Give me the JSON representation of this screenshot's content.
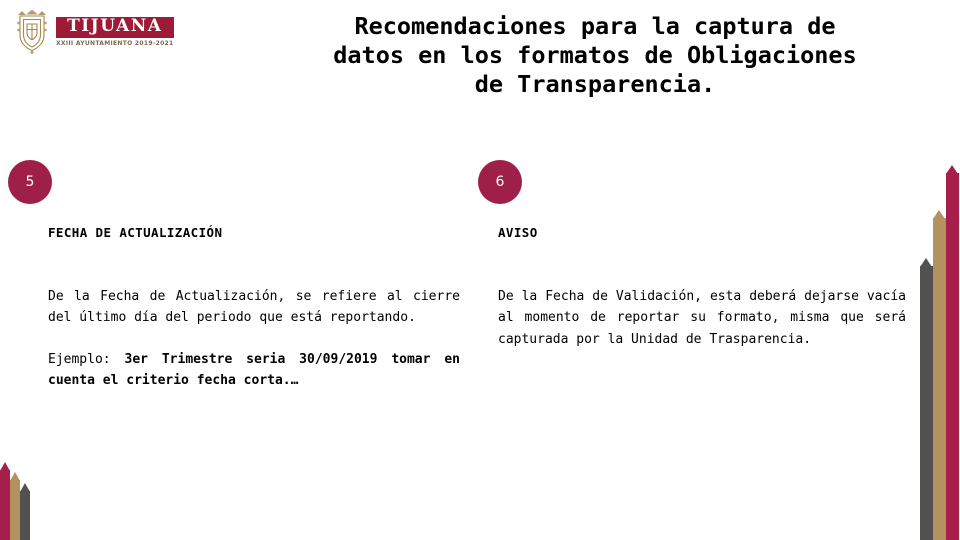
{
  "slide": {
    "background_color": "#ffffff",
    "title": {
      "lines": [
        "Recomendaciones para la captura de",
        "datos en los formatos de Obligaciones",
        "de Transparencia."
      ]
    },
    "logo": {
      "crest_icon": "tijuana-coat-of-arms-icon",
      "wordmark": "TIJUANA",
      "subtitle": "XXIII AYUNTAMIENTO 2019-2021",
      "wordmark_bg_color": "#9e1b38",
      "crest_color": "#a8894f"
    },
    "columns": [
      {
        "badge": "5",
        "heading": "FECHA DE ACTUALIZACIÓN",
        "paragraphs": [
          {
            "runs": [
              {
                "text": "De la Fecha de Actualización, se refiere al cierre del último día del periodo que está reportando.",
                "bold": false
              }
            ]
          },
          {
            "runs": [
              {
                "text": "Ejemplo: ",
                "bold": false
              },
              {
                "text": "3er Trimestre seria 30/09/2019 tomar en cuenta el criterio fecha corta.…",
                "bold": true
              }
            ]
          }
        ]
      },
      {
        "badge": "6",
        "heading": "AVISO",
        "paragraphs": [
          {
            "runs": [
              {
                "text": "De la Fecha de Validación, esta deberá dejarse vacía al momento de reportar su formato, misma que será capturada por la Unidad de Trasparencia.",
                "bold": false
              }
            ]
          }
        ]
      }
    ],
    "decor": {
      "badge_color": "#9e2049",
      "bar_colors": {
        "gray": "#53514f",
        "tan": "#b3925f",
        "crimson": "#a61f4b"
      }
    }
  }
}
